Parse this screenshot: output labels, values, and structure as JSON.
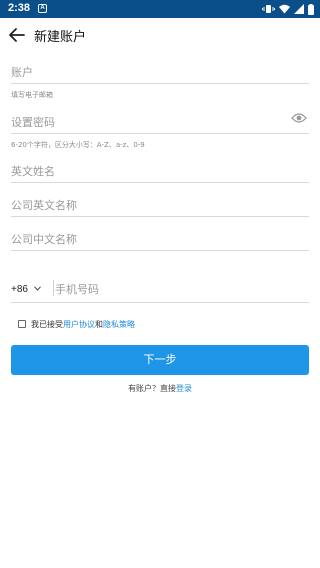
{
  "status_bar": {
    "time": "2:38",
    "notification_glyph": "A"
  },
  "header": {
    "title": "新建账户"
  },
  "form": {
    "account": {
      "placeholder": "账户",
      "hint": "填写电子邮箱"
    },
    "password": {
      "placeholder": "设置密码",
      "hint": "6-20个字符，区分大小写：A-Z、a-z、0-9"
    },
    "english_name": {
      "placeholder": "英文姓名"
    },
    "company_en": {
      "placeholder": "公司英文名称"
    },
    "company_cn": {
      "placeholder": "公司中文名称"
    },
    "phone": {
      "country_code": "+86",
      "placeholder": "手机号码"
    }
  },
  "agreement": {
    "prefix": "我已接受",
    "user_agreement": "用户协议",
    "and": "和",
    "privacy_policy": "隐私策略"
  },
  "next_button": {
    "label": "下一步"
  },
  "login_prompt": {
    "text": "有账户？直接",
    "link": "登录"
  },
  "colors": {
    "status_bar": "#0b4f8a",
    "accent": "#1e95e6",
    "link": "#1f8ad8"
  }
}
